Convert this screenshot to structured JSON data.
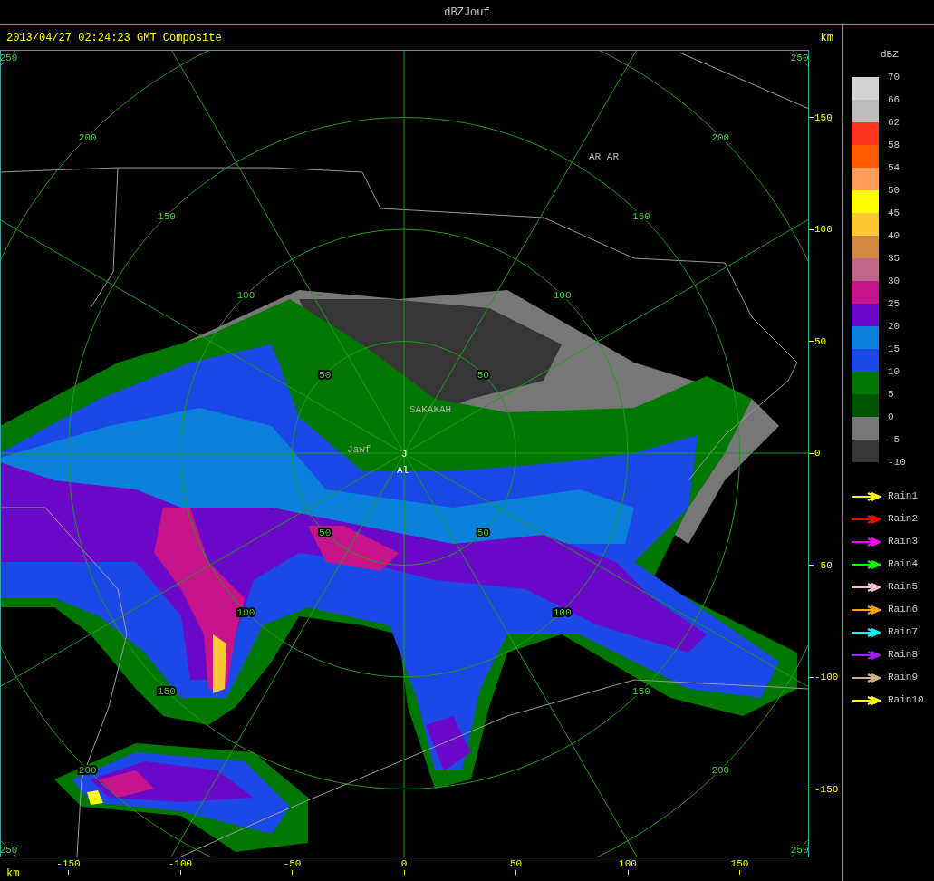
{
  "window": {
    "title": "dBZJouf"
  },
  "header": {
    "timestamp": "2013/04/27 02:24:23 GMT Composite",
    "unit": "km"
  },
  "map": {
    "range_rings": [
      {
        "labels": [
          "50",
          "50",
          "50",
          "50"
        ]
      },
      {
        "labels": [
          "100",
          "100",
          "100",
          "100"
        ]
      },
      {
        "labels": [
          "150",
          "150",
          "150",
          "150"
        ]
      },
      {
        "labels": [
          "200",
          "200",
          "200",
          "200"
        ]
      },
      {
        "labels": [
          "250",
          "250",
          "250",
          "250"
        ]
      }
    ],
    "places": [
      {
        "name": "AR_AR",
        "kind": "city"
      },
      {
        "name": "SAKAKAH",
        "kind": "city"
      },
      {
        "name": "Jawf",
        "kind": "city"
      },
      {
        "name": "J",
        "kind": "site"
      },
      {
        "name": "Al",
        "kind": "site"
      }
    ]
  },
  "y_axis": {
    "ticks": [
      "150",
      "100",
      "50",
      "0",
      "-50",
      "-100",
      "-150"
    ]
  },
  "x_axis": {
    "unit": "km",
    "ticks": [
      "-150",
      "-100",
      "-50",
      "0",
      "50",
      "100",
      "150"
    ]
  },
  "legend": {
    "title": "dBZ",
    "scale_labels": [
      "70",
      "66",
      "62",
      "58",
      "54",
      "50",
      "45",
      "40",
      "35",
      "30",
      "25",
      "20",
      "15",
      "10",
      "5",
      "0",
      "-5",
      "-10"
    ],
    "bands": [
      {
        "color": "#d3d3d3"
      },
      {
        "color": "#bdbdbd"
      },
      {
        "color": "#ff3520"
      },
      {
        "color": "#ff5a00"
      },
      {
        "color": "#ff9c5a"
      },
      {
        "color": "#ffff00"
      },
      {
        "color": "#fbc832"
      },
      {
        "color": "#d08a3f"
      },
      {
        "color": "#bd6a8a"
      },
      {
        "color": "#c8148a"
      },
      {
        "color": "#6a0ac8"
      },
      {
        "color": "#0a80dc"
      },
      {
        "color": "#1c48e8"
      },
      {
        "color": "#007800"
      },
      {
        "color": "#005400"
      },
      {
        "color": "#777777"
      },
      {
        "color": "#363636"
      }
    ],
    "tracks": [
      {
        "label": "Rain1",
        "color": "#ffff00"
      },
      {
        "label": "Rain2",
        "color": "#ff0000"
      },
      {
        "label": "Rain3",
        "color": "#ff00ff"
      },
      {
        "label": "Rain4",
        "color": "#00ff00"
      },
      {
        "label": "Rain5",
        "color": "#ffc0cb"
      },
      {
        "label": "Rain6",
        "color": "#ffa500"
      },
      {
        "label": "Rain7",
        "color": "#00ffff"
      },
      {
        "label": "Rain8",
        "color": "#a020f0"
      },
      {
        "label": "Rain9",
        "color": "#d2b48c"
      },
      {
        "label": "Rain10",
        "color": "#ffff00"
      }
    ]
  }
}
